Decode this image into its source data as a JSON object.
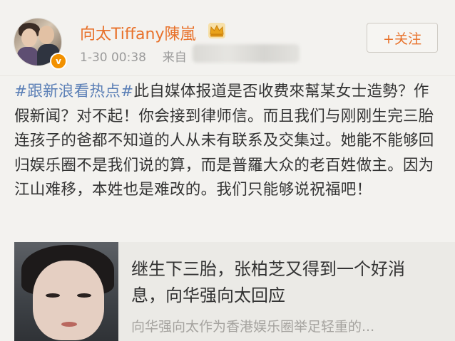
{
  "post": {
    "author": {
      "name": "向太Tiffany陳嵐",
      "verified_mark": "v",
      "crown_icon": "crown-icon",
      "brand_color": "#e8712a"
    },
    "time": "1-30 00:38",
    "source_label": "来自",
    "follow_label": "+关注",
    "hashtag": "#跟新浪看热点#",
    "body": "此自媒体报道是否收费來幫某女士造勢？作假新闻？对不起！你会接到律师信。而且我们与刚刚生完三胎连孩子的爸都不知道的人从未有联系及交集过。她能不能够回归娱乐圈不是我们说的算，而是普羅大众的老百姓做主。因为江山难移，本姓也是难改的。我们只能够说祝福吧！",
    "colors": {
      "hashtag": "#5b7fb6",
      "text": "#333333",
      "meta": "#9a9a9a"
    }
  },
  "card": {
    "title": "继生下三胎，张柏芝又得到一个好消息，向华强向太回应",
    "summary": "向华强向太作为香港娱乐圈举足轻重的..."
  }
}
